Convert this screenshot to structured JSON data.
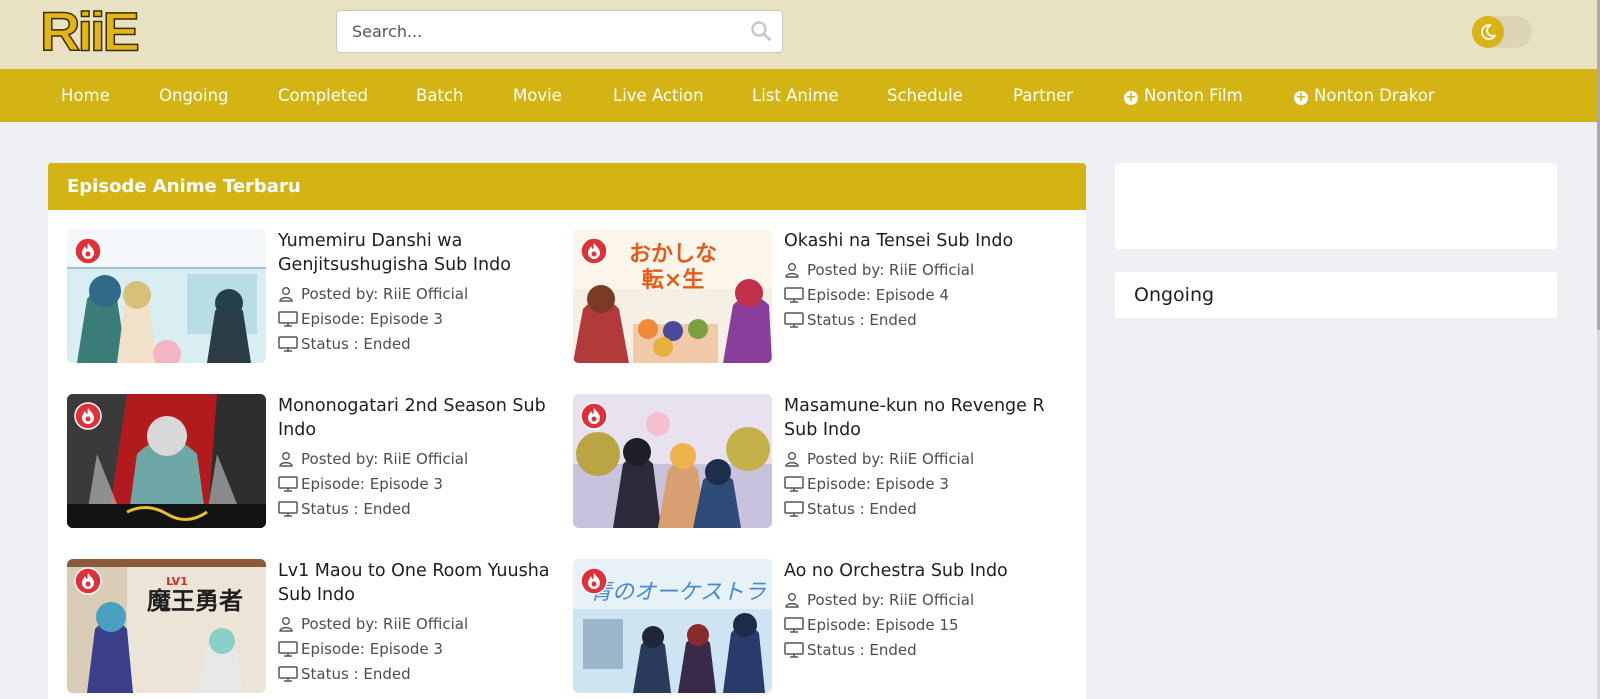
{
  "site": {
    "logo": "RiiE"
  },
  "search": {
    "placeholder": "Search..."
  },
  "theme_toggle": {
    "mode": "light",
    "icon": "moon-icon"
  },
  "nav": {
    "items": [
      {
        "label": "Home"
      },
      {
        "label": "Ongoing"
      },
      {
        "label": "Completed"
      },
      {
        "label": "Batch"
      },
      {
        "label": "Movie"
      },
      {
        "label": "Live Action"
      },
      {
        "label": "List Anime"
      },
      {
        "label": "Schedule"
      },
      {
        "label": "Partner"
      },
      {
        "label": "Nonton Film",
        "icon": "plus-circle-icon"
      },
      {
        "label": "Nonton Drakor",
        "icon": "plus-circle-icon"
      }
    ]
  },
  "main": {
    "title": "Episode Anime Terbaru",
    "posts": [
      {
        "title": "Yumemiru Danshi wa Genjitsushugisha Sub Indo",
        "posted_by": "Posted by: RiiE Official",
        "episode": "Episode: Episode 3",
        "status": "Status : Ended"
      },
      {
        "title": "Okashi na Tensei Sub Indo",
        "posted_by": "Posted by: RiiE Official",
        "episode": "Episode: Episode 4",
        "status": "Status : Ended"
      },
      {
        "title": "Mononogatari 2nd Season Sub Indo",
        "posted_by": "Posted by: RiiE Official",
        "episode": "Episode: Episode 3",
        "status": "Status : Ended"
      },
      {
        "title": "Masamune-kun no Revenge R Sub Indo",
        "posted_by": "Posted by: RiiE Official",
        "episode": "Episode: Episode 3",
        "status": "Status : Ended"
      },
      {
        "title": "Lv1 Maou to One Room Yuusha Sub Indo",
        "posted_by": "Posted by: RiiE Official",
        "episode": "Episode: Episode 3",
        "status": "Status : Ended"
      },
      {
        "title": "Ao no Orchestra Sub Indo",
        "posted_by": "Posted by: RiiE Official",
        "episode": "Episode: Episode 15",
        "status": "Status : Ended"
      }
    ]
  },
  "sidebar": {
    "ongoing_title": "Ongoing"
  },
  "colors": {
    "accent": "#d4b414",
    "header_bg": "#e8e2c3",
    "page_bg": "#eef0f3",
    "badge": "#e0303a"
  }
}
